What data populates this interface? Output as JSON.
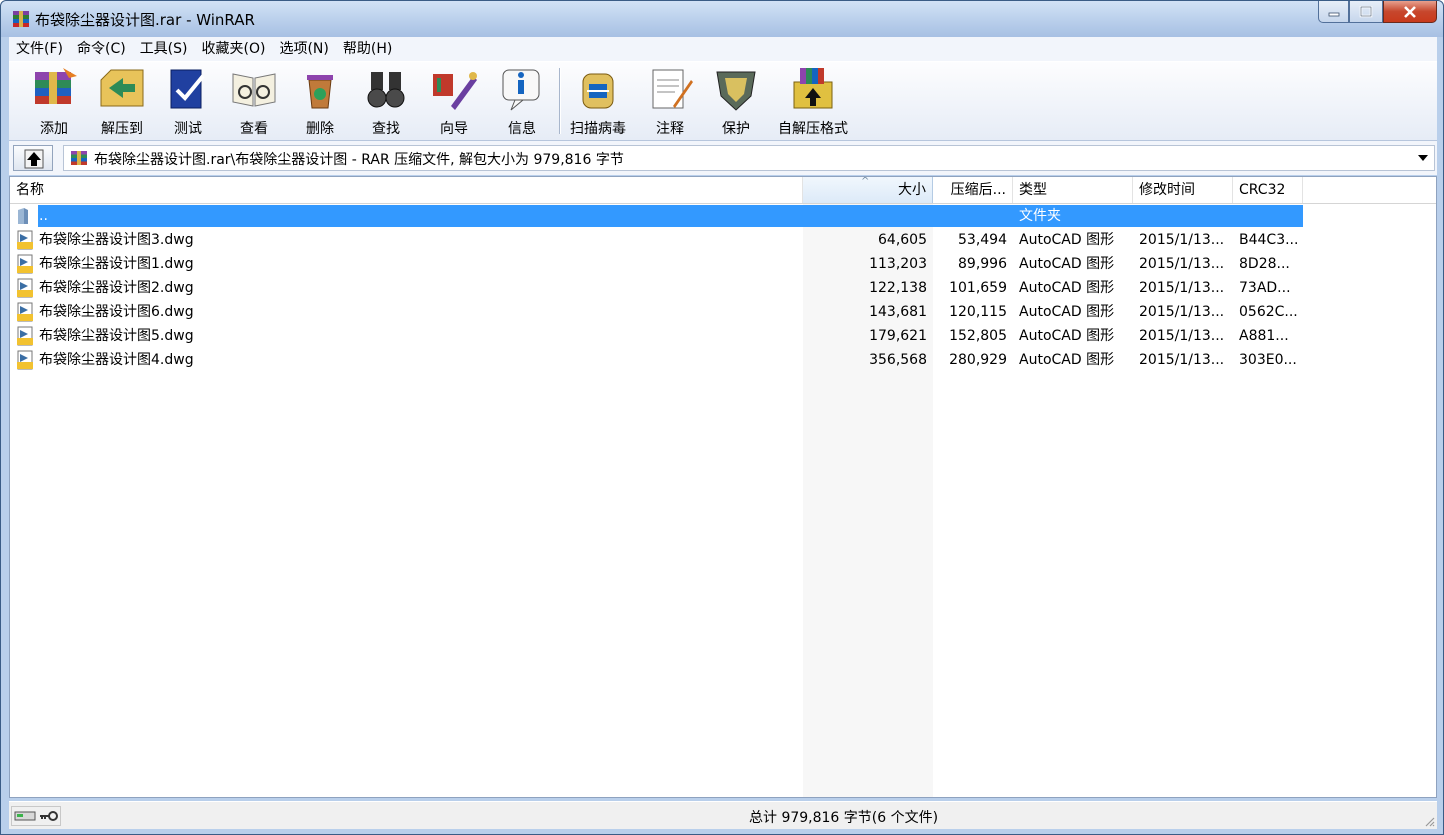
{
  "window": {
    "title": "布袋除尘器设计图.rar - WinRAR",
    "minimize_icon": "minimize-icon",
    "maximize_icon": "maximize-icon",
    "close_icon": "close-icon"
  },
  "menu": [
    "文件(F)",
    "命令(C)",
    "工具(S)",
    "收藏夹(O)",
    "选项(N)",
    "帮助(H)"
  ],
  "toolbar": [
    {
      "label": "添加",
      "icon": "add-archive-icon"
    },
    {
      "label": "解压到",
      "icon": "extract-to-icon"
    },
    {
      "label": "测试",
      "icon": "test-icon"
    },
    {
      "label": "查看",
      "icon": "view-icon"
    },
    {
      "label": "删除",
      "icon": "delete-icon"
    },
    {
      "label": "查找",
      "icon": "find-icon"
    },
    {
      "label": "向导",
      "icon": "wizard-icon"
    },
    {
      "label": "信息",
      "icon": "info-icon"
    },
    {
      "label": "扫描病毒",
      "icon": "scan-virus-icon"
    },
    {
      "label": "注释",
      "icon": "comment-icon"
    },
    {
      "label": "保护",
      "icon": "protect-icon"
    },
    {
      "label": "自解压格式",
      "icon": "sfx-icon"
    }
  ],
  "address": {
    "path": "布袋除尘器设计图.rar\\布袋除尘器设计图 - RAR 压缩文件, 解包大小为 979,816 字节"
  },
  "columns": {
    "name": "名称",
    "size": "大小",
    "packed": "压缩后...",
    "type": "类型",
    "modified": "修改时间",
    "crc": "CRC32"
  },
  "parent_row": {
    "name": "..",
    "type": "文件夹"
  },
  "files": [
    {
      "name": "布袋除尘器设计图3.dwg",
      "size": "64,605",
      "packed": "53,494",
      "type": "AutoCAD 图形",
      "modified": "2015/1/13...",
      "crc": "B44C3..."
    },
    {
      "name": "布袋除尘器设计图1.dwg",
      "size": "113,203",
      "packed": "89,996",
      "type": "AutoCAD 图形",
      "modified": "2015/1/13...",
      "crc": "8D28..."
    },
    {
      "name": "布袋除尘器设计图2.dwg",
      "size": "122,138",
      "packed": "101,659",
      "type": "AutoCAD 图形",
      "modified": "2015/1/13...",
      "crc": "73AD..."
    },
    {
      "name": "布袋除尘器设计图6.dwg",
      "size": "143,681",
      "packed": "120,115",
      "type": "AutoCAD 图形",
      "modified": "2015/1/13...",
      "crc": "0562C..."
    },
    {
      "name": "布袋除尘器设计图5.dwg",
      "size": "179,621",
      "packed": "152,805",
      "type": "AutoCAD 图形",
      "modified": "2015/1/13...",
      "crc": "A881..."
    },
    {
      "name": "布袋除尘器设计图4.dwg",
      "size": "356,568",
      "packed": "280,929",
      "type": "AutoCAD 图形",
      "modified": "2015/1/13...",
      "crc": "303E0..."
    }
  ],
  "status": {
    "text": "总计 979,816 字节(6 个文件)"
  },
  "colors": {
    "selection": "#3399ff"
  }
}
